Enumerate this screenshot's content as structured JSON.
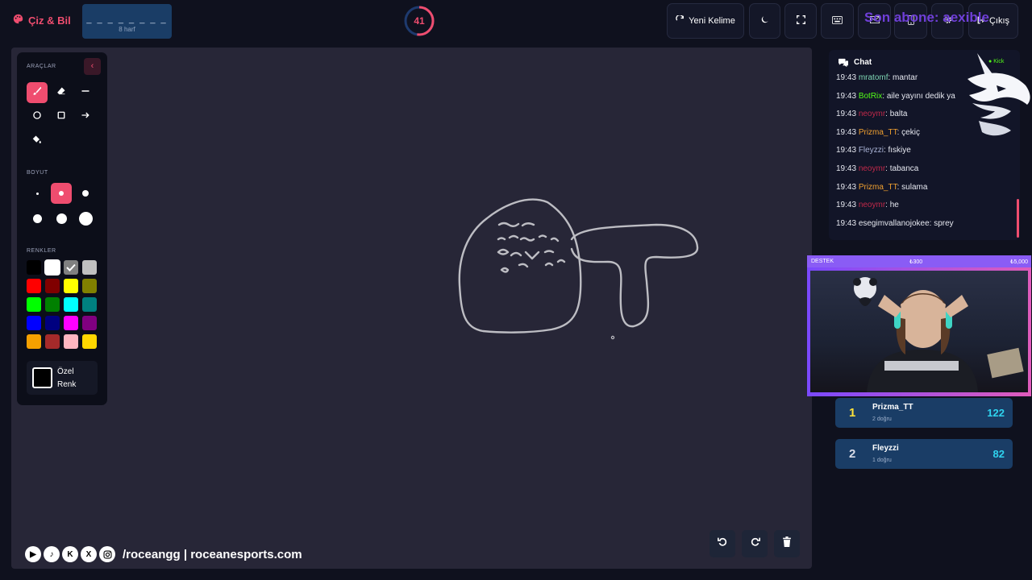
{
  "header": {
    "brand": "Çiz & Bil",
    "word_dashes": "_ _ _ _ _ _ _ _",
    "word_length": "8 harf",
    "timer": "41",
    "new_word_label": "Yeni Kelime",
    "exit_label": "Çıkış",
    "subscriber_ticker": "Son abone: aexible"
  },
  "tools": {
    "section_tools": "ARAÇLAR",
    "section_size": "BOYUT",
    "section_colors": "RENKLER",
    "custom_color_label": "Özel Renk",
    "colors": [
      "#000000",
      "#ffffff",
      "#808080",
      "#c0c0c0",
      "#ff0000",
      "#800000",
      "#ffff00",
      "#808000",
      "#00ff00",
      "#008000",
      "#00ffff",
      "#008080",
      "#0000ff",
      "#000080",
      "#ff00ff",
      "#800080",
      "#f5a000",
      "#a52a2a",
      "#ffb6c1",
      "#ffd700"
    ]
  },
  "social": {
    "handle_text": "/roceangg | roceanesports.com"
  },
  "chat": {
    "title": "Chat",
    "platform": "Kick",
    "messages": [
      {
        "time": "19:43",
        "user": "mratomf",
        "text": ": mantar",
        "color": "#7fd7b4"
      },
      {
        "time": "19:43",
        "user": "BotRix",
        "text": ": aile yayını dedik ya",
        "color": "#53fc18"
      },
      {
        "time": "19:43",
        "user": "neoymr",
        "text": ": balta",
        "color": "#c0294a"
      },
      {
        "time": "19:43",
        "user": "Prizma_TT",
        "text": ": çekiç",
        "color": "#f0a030"
      },
      {
        "time": "19:43",
        "user": "Fleyzzi",
        "text": ": fıskiye",
        "color": "#aab4d6"
      },
      {
        "time": "19:43",
        "user": "neoymr",
        "text": ": tabanca",
        "color": "#c0294a"
      },
      {
        "time": "19:43",
        "user": "Prizma_TT",
        "text": ": sulama",
        "color": "#f0a030"
      },
      {
        "time": "19:43",
        "user": "neoymr",
        "text": ": he",
        "color": "#c0294a"
      },
      {
        "time": "19:43",
        "user": "esegimvallanojokee",
        "text": ": sprey",
        "color": "#e6e8f0"
      }
    ]
  },
  "donation_bar": {
    "label": "DESTEK",
    "current": "₺300",
    "goal": "₺5,000"
  },
  "leaderboard": [
    {
      "rank": "1",
      "name": "Prizma_TT",
      "sub": "2 doğru",
      "points": "122",
      "rank_color": "#ffe23a"
    },
    {
      "rank": "2",
      "name": "Fleyzzi",
      "sub": "1 doğru",
      "points": "82",
      "rank_color": "#d9dde8"
    }
  ]
}
